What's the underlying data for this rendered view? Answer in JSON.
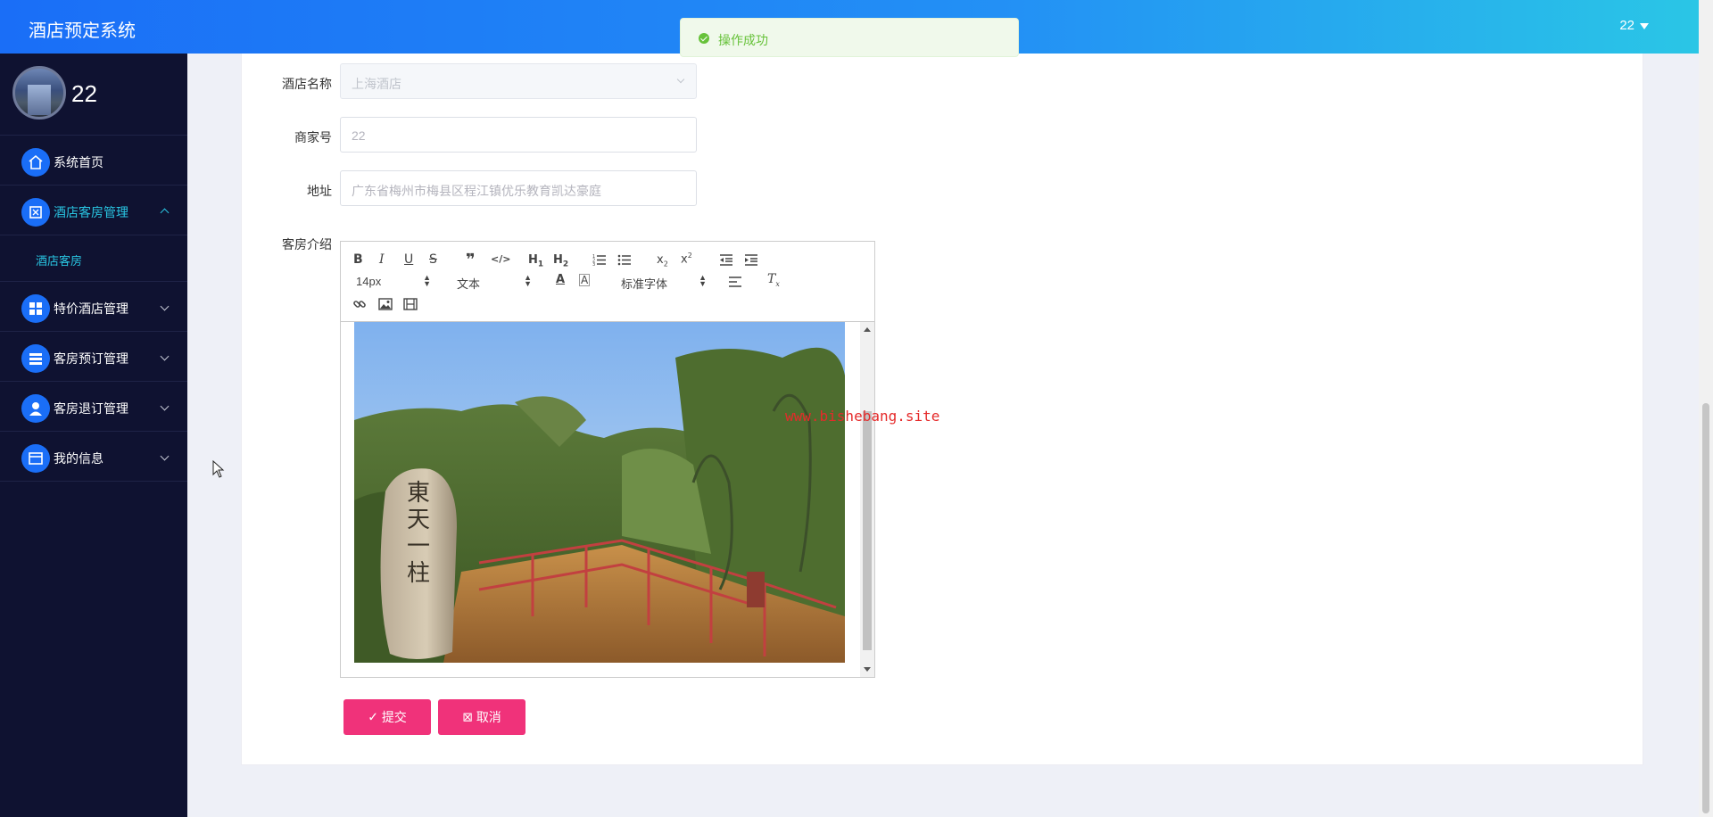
{
  "header": {
    "title": "酒店预定系统",
    "user": "22"
  },
  "toast": {
    "message": "操作成功"
  },
  "sidebar": {
    "username": "22",
    "items": [
      {
        "label": "系统首页",
        "icon": "home-icon"
      },
      {
        "label": "酒店客房管理",
        "icon": "hotel-icon",
        "expanded": true,
        "sub": [
          "酒店客房"
        ]
      },
      {
        "label": "特价酒店管理",
        "icon": "grid-icon"
      },
      {
        "label": "客房预订管理",
        "icon": "list-icon"
      },
      {
        "label": "客房退订管理",
        "icon": "user-icon"
      },
      {
        "label": "我的信息",
        "icon": "card-icon"
      }
    ]
  },
  "form": {
    "hotel_name_label": "酒店名称",
    "hotel_name_value": "上海酒店",
    "merchant_label": "商家号",
    "merchant_value": "22",
    "address_label": "地址",
    "address_value": "广东省梅州市梅县区程江镇优乐教育凯达豪庭",
    "intro_label": "客房介绍"
  },
  "editor": {
    "font_size": "14px",
    "text_style": "文本",
    "font_family": "标准字体",
    "image_text": "東天一柱"
  },
  "buttons": {
    "submit": "提交",
    "cancel": "取消"
  },
  "watermark": "www.bishebang.site"
}
